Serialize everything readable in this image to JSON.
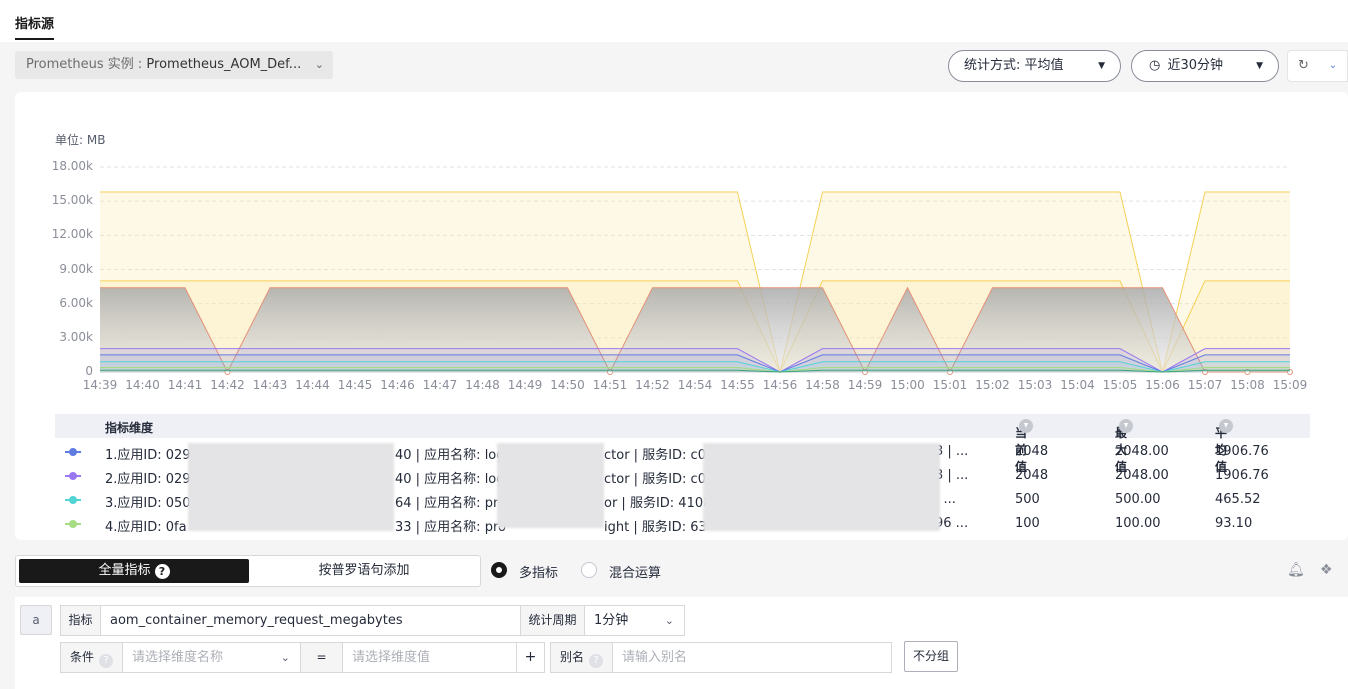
{
  "tab": {
    "label": "指标源"
  },
  "prometheus": {
    "prefix": "Prometheus 实例 : ",
    "value": "Prometheus_AOM_Def..."
  },
  "stat_mode": {
    "label": "统计方式: 平均值"
  },
  "time_range": {
    "label": "近30分钟"
  },
  "chart_data": {
    "type": "area",
    "unit_label": "单位: MB",
    "y_ticks": [
      "18.00k",
      "15.00k",
      "12.00k",
      "9.00k",
      "6.00k",
      "3.00k",
      "0"
    ],
    "ylim": [
      0,
      18000
    ],
    "x": [
      "14:39",
      "14:40",
      "14:41",
      "14:42",
      "14:43",
      "14:44",
      "14:45",
      "14:46",
      "14:47",
      "14:48",
      "14:49",
      "14:50",
      "14:51",
      "14:52",
      "14:54",
      "14:55",
      "14:56",
      "14:58",
      "14:59",
      "15:00",
      "15:01",
      "15:02",
      "15:03",
      "15:04",
      "15:05",
      "15:06",
      "15:07",
      "15:08",
      "15:09"
    ],
    "series": [
      {
        "color": "#f5d155",
        "fill": "rgba(252,232,160,0.25)",
        "values": [
          15800,
          15800,
          15800,
          15800,
          15800,
          15800,
          15800,
          15800,
          15800,
          15800,
          15800,
          15800,
          15800,
          15800,
          15800,
          15800,
          0,
          15800,
          15800,
          15800,
          15800,
          15800,
          15800,
          15800,
          15800,
          0,
          15800,
          15800,
          15800
        ]
      },
      {
        "color": "#f5d155",
        "fill": "rgba(252,232,160,0.25)",
        "values": [
          8000,
          8000,
          8000,
          8000,
          8000,
          8000,
          8000,
          8000,
          8000,
          8000,
          8000,
          8000,
          8000,
          8000,
          8000,
          8000,
          0,
          8000,
          8000,
          8000,
          8000,
          8000,
          8000,
          8000,
          8000,
          0,
          8000,
          8000,
          8000
        ]
      },
      {
        "color": "#e49277",
        "fill": "gradient",
        "values": [
          7400,
          7400,
          7400,
          0,
          7400,
          7400,
          7400,
          7400,
          7400,
          7400,
          7400,
          7400,
          0,
          7400,
          7400,
          7400,
          7400,
          7400,
          0,
          7400,
          0,
          7400,
          7400,
          7400,
          7400,
          7400,
          0,
          0,
          0
        ]
      },
      {
        "color": "#9a78f2",
        "fill": "rgba(154,120,242,0.12)",
        "values": [
          2048,
          2048,
          2048,
          2048,
          2048,
          2048,
          2048,
          2048,
          2048,
          2048,
          2048,
          2048,
          2048,
          2048,
          2048,
          2048,
          0,
          2048,
          2048,
          2048,
          2048,
          2048,
          2048,
          2048,
          2048,
          0,
          2048,
          2048,
          2048
        ]
      },
      {
        "color": "#5e7ce0",
        "fill": "rgba(94,124,224,0.10)",
        "values": [
          1500,
          1500,
          1500,
          1500,
          1500,
          1500,
          1500,
          1500,
          1500,
          1500,
          1500,
          1500,
          1500,
          1500,
          1500,
          1500,
          0,
          1500,
          1500,
          1500,
          1500,
          1500,
          1500,
          1500,
          1500,
          0,
          1500,
          1500,
          1500
        ]
      },
      {
        "color": "#50d4d5",
        "fill": "rgba(80,212,213,0.10)",
        "values": [
          900,
          900,
          900,
          900,
          900,
          900,
          900,
          900,
          900,
          900,
          900,
          900,
          900,
          900,
          900,
          900,
          0,
          900,
          900,
          900,
          900,
          900,
          900,
          900,
          900,
          0,
          900,
          900,
          900
        ]
      },
      {
        "color": "#a6dd82",
        "fill": "rgba(166,221,130,0.15)",
        "values": [
          400,
          400,
          400,
          400,
          400,
          400,
          400,
          400,
          400,
          400,
          400,
          400,
          400,
          400,
          400,
          400,
          0,
          400,
          400,
          400,
          400,
          400,
          400,
          400,
          400,
          0,
          400,
          400,
          400
        ]
      },
      {
        "color": "#3ba17f",
        "fill": "none",
        "values": [
          150,
          150,
          150,
          150,
          150,
          150,
          150,
          150,
          150,
          150,
          150,
          150,
          150,
          150,
          150,
          150,
          0,
          150,
          150,
          150,
          150,
          150,
          150,
          150,
          150,
          0,
          150,
          150,
          150
        ]
      }
    ]
  },
  "table": {
    "headers": {
      "dim": "指标维度",
      "cur": "当前值",
      "max": "最大值",
      "avg": "平均值"
    },
    "rows": [
      {
        "color": "#5e7ce0",
        "a": "1.应用ID: 029",
        "b": "40 | 应用名称: log",
        "c": "ctor | 服务ID: c0",
        "d": "3 | ...",
        "cur": "2048",
        "max": "2048.00",
        "avg": "1906.76"
      },
      {
        "color": "#9a78f2",
        "a": "2.应用ID: 029",
        "b": "40 | 应用名称: log",
        "c": "ctor | 服务ID: c0",
        "d": "3 | ...",
        "cur": "2048",
        "max": "2048.00",
        "avg": "1906.76"
      },
      {
        "color": "#50d4d5",
        "a": "3.应用ID: 050",
        "b": "64 | 应用名称: pro",
        "c": "or | 服务ID: 4108",
        "d": "| ...",
        "cur": "500",
        "max": "500.00",
        "avg": "465.52"
      },
      {
        "color": "#a6dd82",
        "a": "4.应用ID: 0fa",
        "b": "33 | 应用名称: pro",
        "c": "ight | 服务ID: 63",
        "d": "96 ...",
        "cur": "100",
        "max": "100.00",
        "avg": "93.10"
      }
    ]
  },
  "toggle": {
    "all_label": "全量指标",
    "help": "?",
    "promql_label": "按普罗语句添加"
  },
  "mode": {
    "multi": "多指标",
    "mixed": "混合运算"
  },
  "query": {
    "alias_tag": "a",
    "metric_label": "指标",
    "metric_value": "aom_container_memory_request_megabytes",
    "period_label": "统计周期",
    "period_value": "1分钟",
    "cond_label": "条件",
    "dim_placeholder": "请选择维度名称",
    "op": "=",
    "val_placeholder": "请选择维度值",
    "plus": "+",
    "alias_label": "别名",
    "alias_placeholder": "请输入别名",
    "nogroup_label": "不分组"
  }
}
